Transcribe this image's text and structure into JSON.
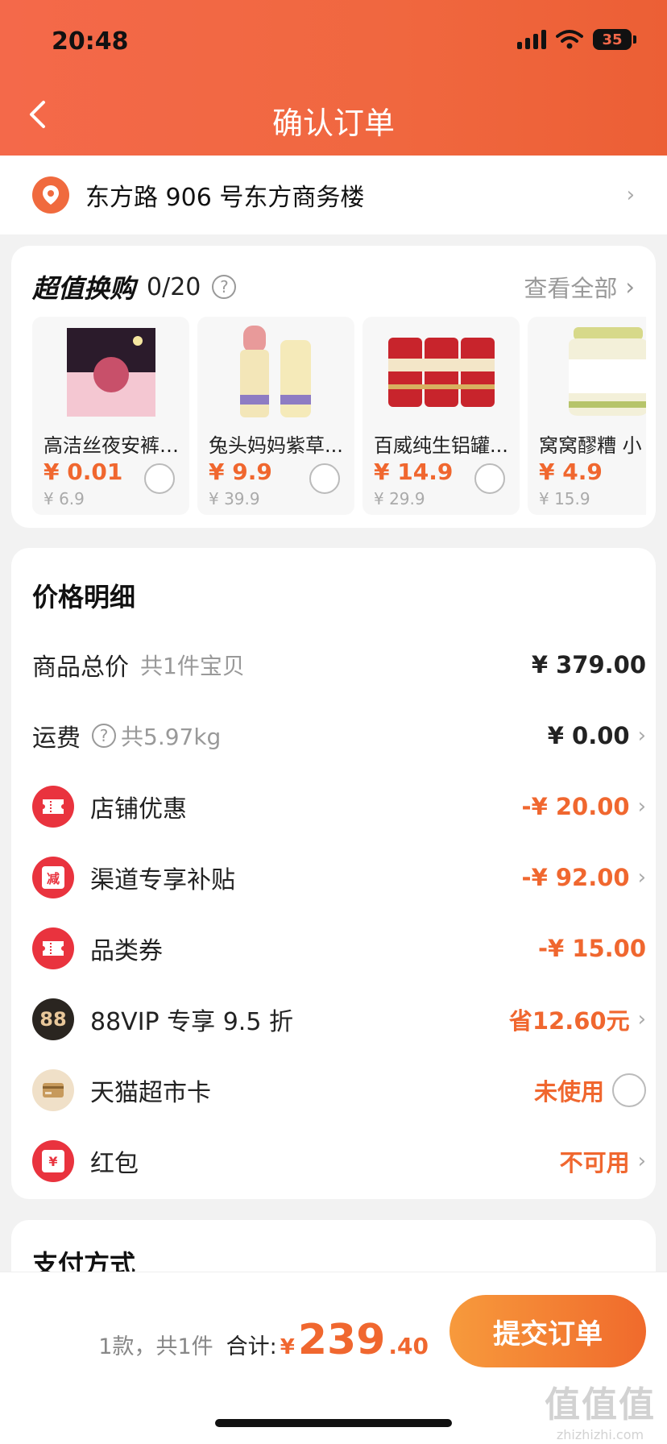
{
  "status_bar": {
    "time": "20:48",
    "battery": "35"
  },
  "nav": {
    "title": "确认订单"
  },
  "address": {
    "text": "东方路 906 号东方商务楼"
  },
  "exchange": {
    "title": "超值换购",
    "count": "0/20",
    "view_all": "查看全部",
    "products": [
      {
        "name": "高洁丝夜安裤 ...",
        "price": "¥ 0.01",
        "orig": "¥ 6.9"
      },
      {
        "name": "兔头妈妈紫草...",
        "price": "¥ 9.9",
        "orig": "¥ 39.9"
      },
      {
        "name": "百威纯生铝罐...",
        "price": "¥ 14.9",
        "orig": "¥ 29.9"
      },
      {
        "name": "窝窝醪糟 小",
        "price": "¥ 4.9",
        "orig": "¥ 15.9"
      }
    ]
  },
  "price_detail": {
    "title": "价格明细",
    "goods_total": {
      "label": "商品总价",
      "sub": "共1件宝贝",
      "value": "¥ 379.00"
    },
    "shipping": {
      "label": "运费",
      "sub": "共5.97kg",
      "value": "¥ 0.00"
    },
    "store_discount": {
      "label": "店铺优惠",
      "value": "-¥ 20.00"
    },
    "channel_subsidy": {
      "label": "渠道专享补贴",
      "value": "-¥ 92.00",
      "icon_text": "减"
    },
    "category_coupon": {
      "label": "品类券",
      "value": "-¥ 15.00"
    },
    "vip": {
      "label": "88VIP 专享 9.5 折",
      "value": "省12.60元",
      "icon_text": "88"
    },
    "tmall_card": {
      "label": "天猫超市卡",
      "value": "未使用"
    },
    "red_packet": {
      "label": "红包",
      "value": "不可用",
      "icon_text": "¥"
    }
  },
  "payment": {
    "title": "支付方式"
  },
  "bottom": {
    "count": "1款，共1件",
    "total_label": "合计:",
    "yen": "¥",
    "total_int": "239",
    "total_dec": ".40",
    "submit": "提交订单"
  },
  "watermark": {
    "logo": "值值值",
    "text": "zhizhizhi.com"
  },
  "colors": {
    "header": "#f4694a",
    "accent": "#f0672f",
    "red_icon": "#e9333e"
  }
}
